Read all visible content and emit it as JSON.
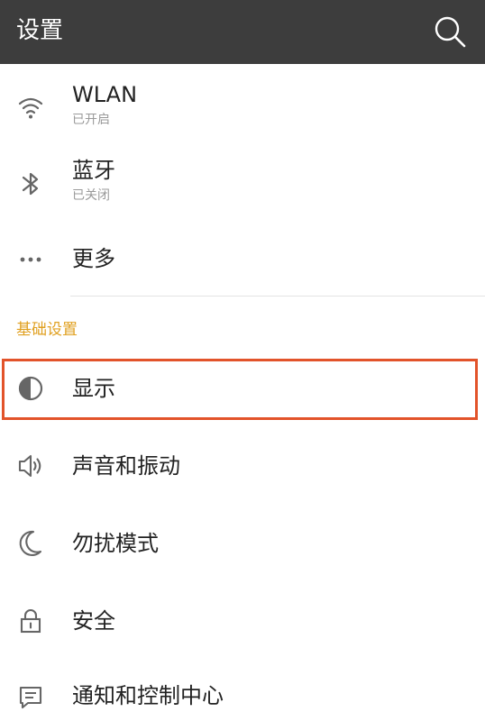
{
  "appbar": {
    "title": "设置",
    "search_icon": "search-icon",
    "background": "#3d3d3d"
  },
  "items": [
    {
      "id": "wlan",
      "icon": "wifi-icon",
      "title": "WLAN",
      "subtitle": "已开启"
    },
    {
      "id": "bluetooth",
      "icon": "bluetooth-icon",
      "title": "蓝牙",
      "subtitle": "已关闭"
    },
    {
      "id": "more",
      "icon": "more-dots-icon",
      "title": "更多"
    }
  ],
  "section": {
    "header": "基础设置",
    "color": "#e0a020"
  },
  "basic_items": [
    {
      "id": "display",
      "icon": "display-contrast-icon",
      "title": "显示",
      "highlighted": true
    },
    {
      "id": "sound",
      "icon": "speaker-icon",
      "title": "声音和振动"
    },
    {
      "id": "dnd",
      "icon": "moon-icon",
      "title": "勿扰模式"
    },
    {
      "id": "security",
      "icon": "lock-icon",
      "title": "安全"
    },
    {
      "id": "notifications",
      "icon": "message-icon",
      "title": "通知和控制中心"
    }
  ],
  "highlight_color": "#e2532a"
}
